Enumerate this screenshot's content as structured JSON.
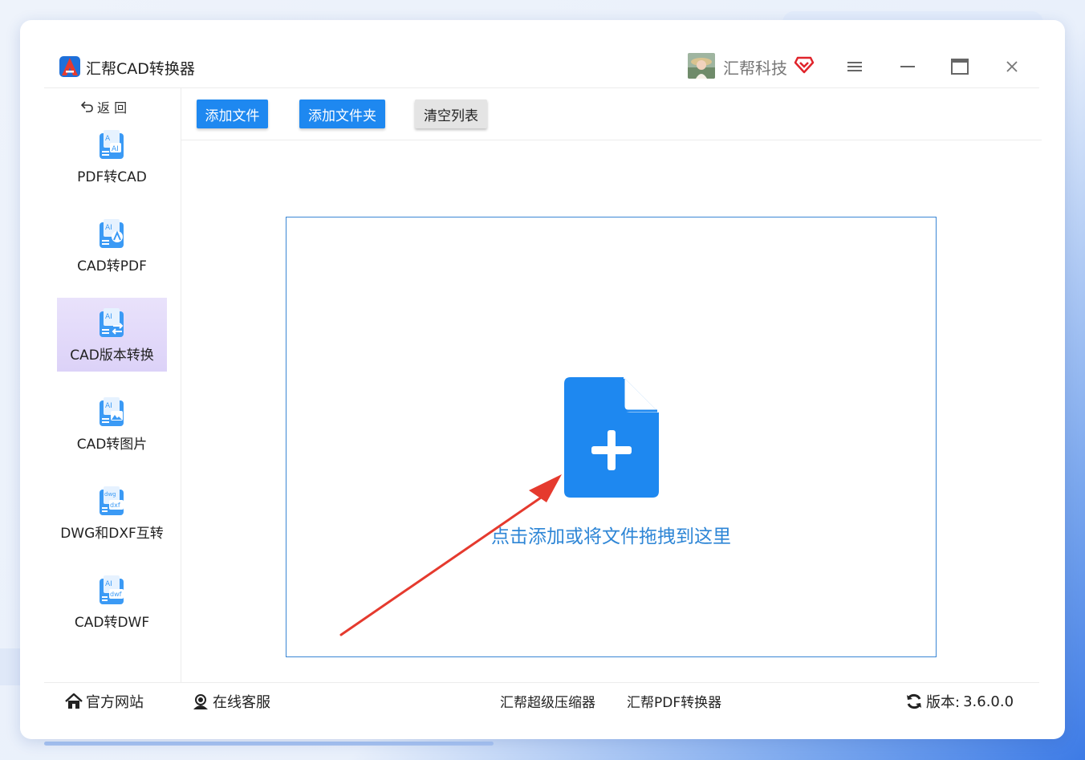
{
  "app": {
    "title": "汇帮CAD转换器",
    "company": "汇帮科技"
  },
  "sidebar": {
    "back_label": "返 回",
    "items": [
      {
        "label": "PDF转CAD",
        "active": false
      },
      {
        "label": "CAD转PDF",
        "active": false
      },
      {
        "label": "CAD版本转换",
        "active": true
      },
      {
        "label": "CAD转图片",
        "active": false
      },
      {
        "label": "DWG和DXF互转",
        "active": false
      },
      {
        "label": "CAD转DWF",
        "active": false
      }
    ]
  },
  "toolbar": {
    "add_file_label": "添加文件",
    "add_folder_label": "添加文件夹",
    "clear_label": "清空列表"
  },
  "dropzone": {
    "text": "点击添加或将文件拖拽到这里"
  },
  "footer": {
    "website_label": "官方网站",
    "support_label": "在线客服",
    "compressor_label": "汇帮超级压缩器",
    "pdf_converter_label": "汇帮PDF转换器",
    "version_label": "版本:",
    "version_value": "3.6.0.0"
  },
  "colors": {
    "accent": "#1e88f0",
    "active_bg": "#e4dcfa",
    "drop_text": "#2e86d6",
    "arrow": "#e53a2e"
  }
}
